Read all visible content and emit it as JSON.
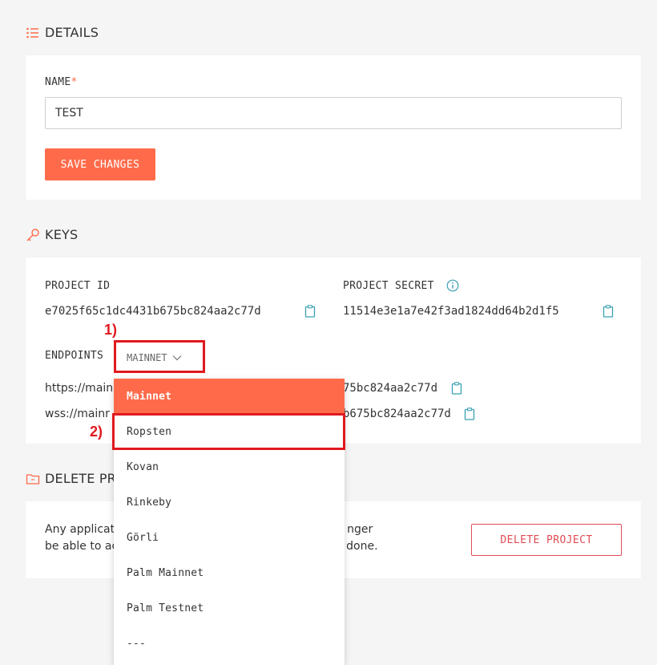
{
  "details": {
    "heading": "DETAILS",
    "name_label": "NAME",
    "required_mark": "*",
    "name_value": "TEST",
    "save_label": "SAVE CHANGES"
  },
  "keys": {
    "heading": "KEYS",
    "project_id_label": "PROJECT ID",
    "project_id_value": "e7025f65c1dc4431b675bc824aa2c77d",
    "project_secret_label": "PROJECT SECRET",
    "project_secret_value": "11514e3e1a7e42f3ad1824dd64b2d1f5",
    "endpoints_label": "ENDPOINTS",
    "network_selected": "MAINNET",
    "https_prefix": "https://main",
    "https_suffix": "75bc824aa2c77d",
    "wss_prefix": "wss://mainr",
    "wss_suffix": "b675bc824aa2c77d"
  },
  "delete": {
    "heading": "DELETE PR",
    "text_line1_a": "Any applicat",
    "text_line1_b": "nger",
    "text_line2_a": "be able to ac",
    "text_line2_b": "done.",
    "button_label": "DELETE PROJECT"
  },
  "dropdown": {
    "items": [
      "Mainnet",
      "Ropsten",
      "Kovan",
      "Rinkeby",
      "Görli",
      "Palm Mainnet",
      "Palm Testnet",
      "---"
    ],
    "selected": "Mainnet"
  },
  "annotations": {
    "label1": "1)",
    "label2": "2)"
  },
  "colors": {
    "accent": "#ff6b4a",
    "danger": "#e04b55",
    "annotation": "#e0191f",
    "copy_icon": "#3aa0b3"
  }
}
